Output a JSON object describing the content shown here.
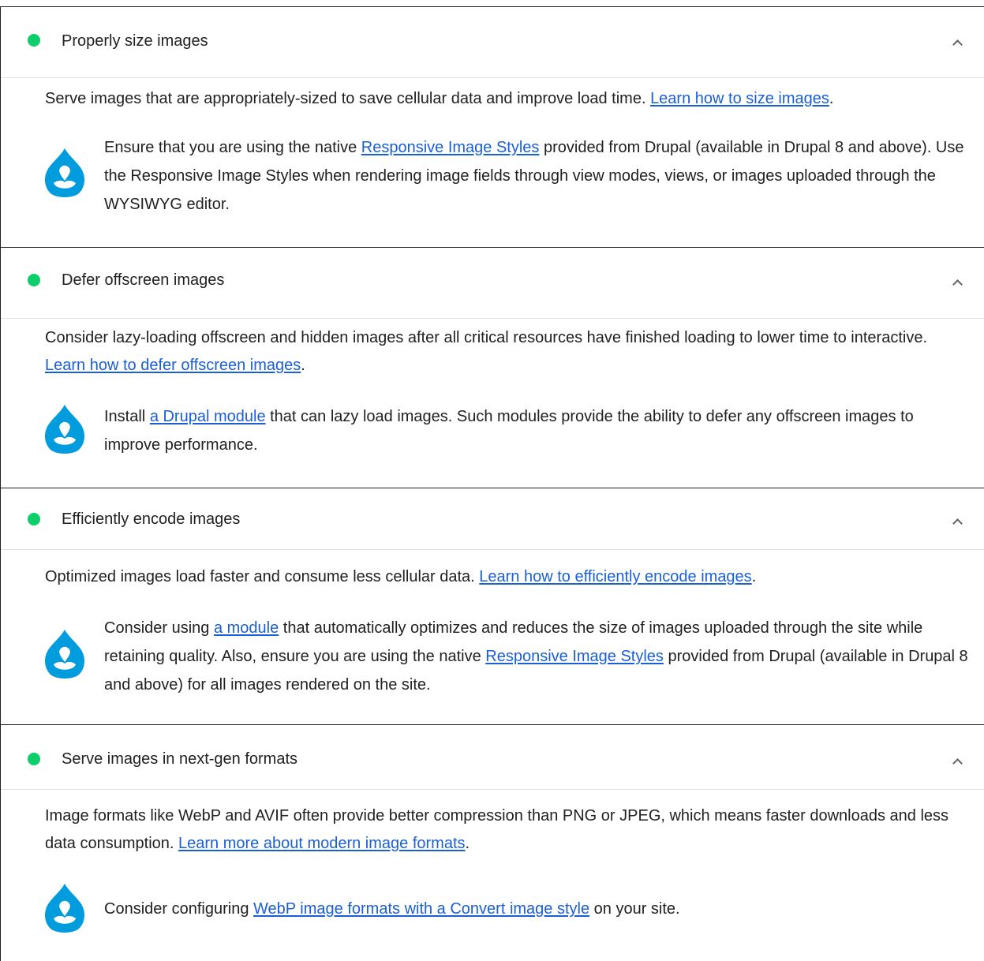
{
  "audits": [
    {
      "title": "Properly size images",
      "desc_before": "Serve images that are appropriately-sized to save cellular data and improve load time. ",
      "desc_link": "Learn how to size images",
      "desc_after": ".",
      "stack_p1": "Ensure that you are using the native ",
      "stack_l1": "Responsive Image Styles",
      "stack_p2": " provided from Drupal (available in Drupal 8 and above). Use the Responsive Image Styles when rendering image fields through view modes, views, or images uploaded through the WYSIWYG editor."
    },
    {
      "title": "Defer offscreen images",
      "desc_before": "Consider lazy-loading offscreen and hidden images after all critical resources have finished loading to lower time to interactive. ",
      "desc_link": "Learn how to defer offscreen images",
      "desc_after": ".",
      "stack_p1": "Install ",
      "stack_l1": "a Drupal module",
      "stack_p2": " that can lazy load images. Such modules provide the ability to defer any offscreen images to improve performance."
    },
    {
      "title": "Efficiently encode images",
      "desc_before": "Optimized images load faster and consume less cellular data. ",
      "desc_link": "Learn how to efficiently encode images",
      "desc_after": ".",
      "stack_p1": "Consider using ",
      "stack_l1": "a module",
      "stack_p2": " that automatically optimizes and reduces the size of images uploaded through the site while retaining quality. Also, ensure you are using the native ",
      "stack_l2": "Responsive Image Styles",
      "stack_p3": " provided from Drupal (available in Drupal 8 and above) for all images rendered on the site."
    },
    {
      "title": "Serve images in next-gen formats",
      "desc_before": "Image formats like WebP and AVIF often provide better compression than PNG or JPEG, which means faster downloads and less data consumption. ",
      "desc_link": "Learn more about modern image formats",
      "desc_after": ".",
      "stack_p1": "Consider configuring ",
      "stack_l1": "WebP image formats with a Convert image style",
      "stack_p2": " on your site."
    }
  ],
  "colors": {
    "pass": "#0cce6b",
    "link": "#1a5fd6",
    "drupal": "#009cde"
  },
  "icons": {
    "status": "pass-dot-icon",
    "expand": "chevron-up-icon",
    "stack": "drupal-icon"
  }
}
